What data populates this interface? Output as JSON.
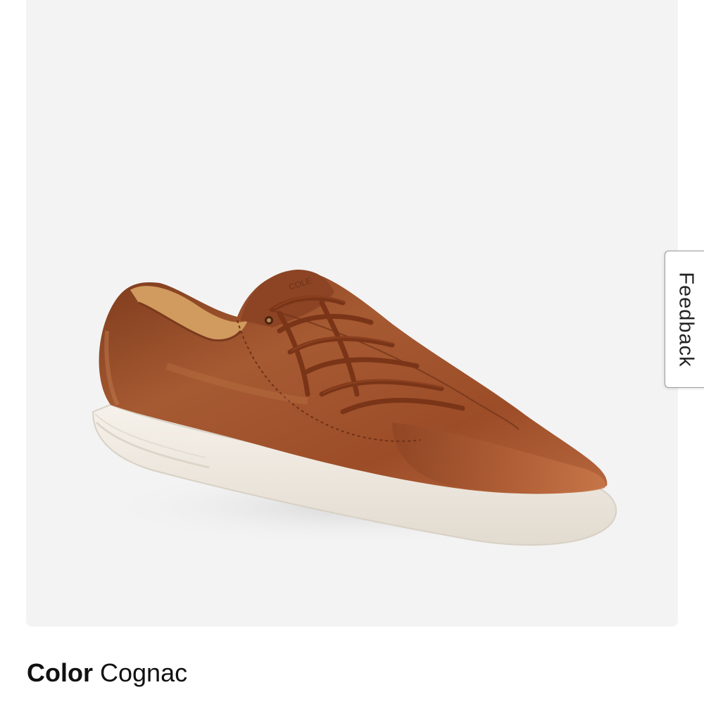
{
  "product_image": {
    "icon": "product-photo-sneaker",
    "background_color": "#f3f3f3",
    "upper_color": "#9e4e2a",
    "sole_color": "#f1ece4"
  },
  "feedback_tab": {
    "label": "Feedback"
  },
  "color_selector": {
    "label": "Color",
    "value": "Cognac"
  }
}
